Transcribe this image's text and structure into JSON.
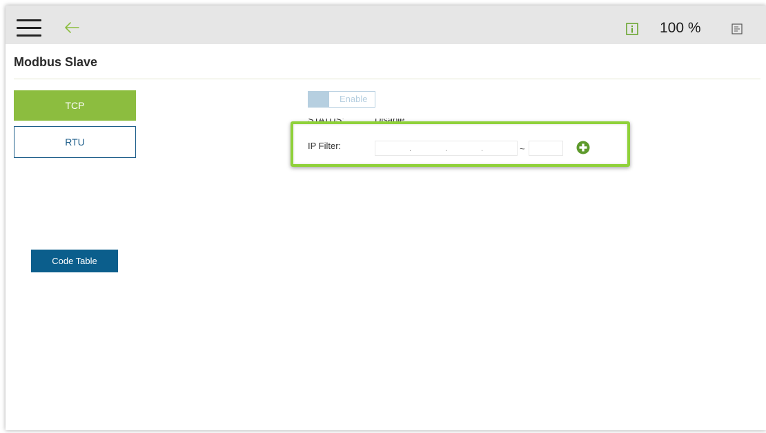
{
  "header": {
    "zoom": "100 %"
  },
  "page": {
    "title": "Modbus Slave"
  },
  "tabs": [
    {
      "label": "TCP",
      "active": true
    },
    {
      "label": "RTU",
      "active": false
    }
  ],
  "actions": {
    "code_table_label": "Code Table"
  },
  "settings": {
    "toggle_label": "Enable",
    "status_label": "STATUS:",
    "status_value": "Disable",
    "ip_filter_label": "IP Filter:",
    "range_separator": "~",
    "ip_start_dots": [
      ".",
      ".",
      "."
    ]
  },
  "icons": {
    "menu": "hamburger-icon",
    "back": "arrow-left-icon",
    "info": "info-icon",
    "log": "log-icon",
    "add": "plus-circle-icon"
  },
  "colors": {
    "accent_green": "#8cbd3f",
    "highlight_green": "#8fd13a",
    "primary_blue": "#0b5e8c",
    "toggle_off": "#b6cfe0",
    "topbar": "#e6e6e6"
  }
}
